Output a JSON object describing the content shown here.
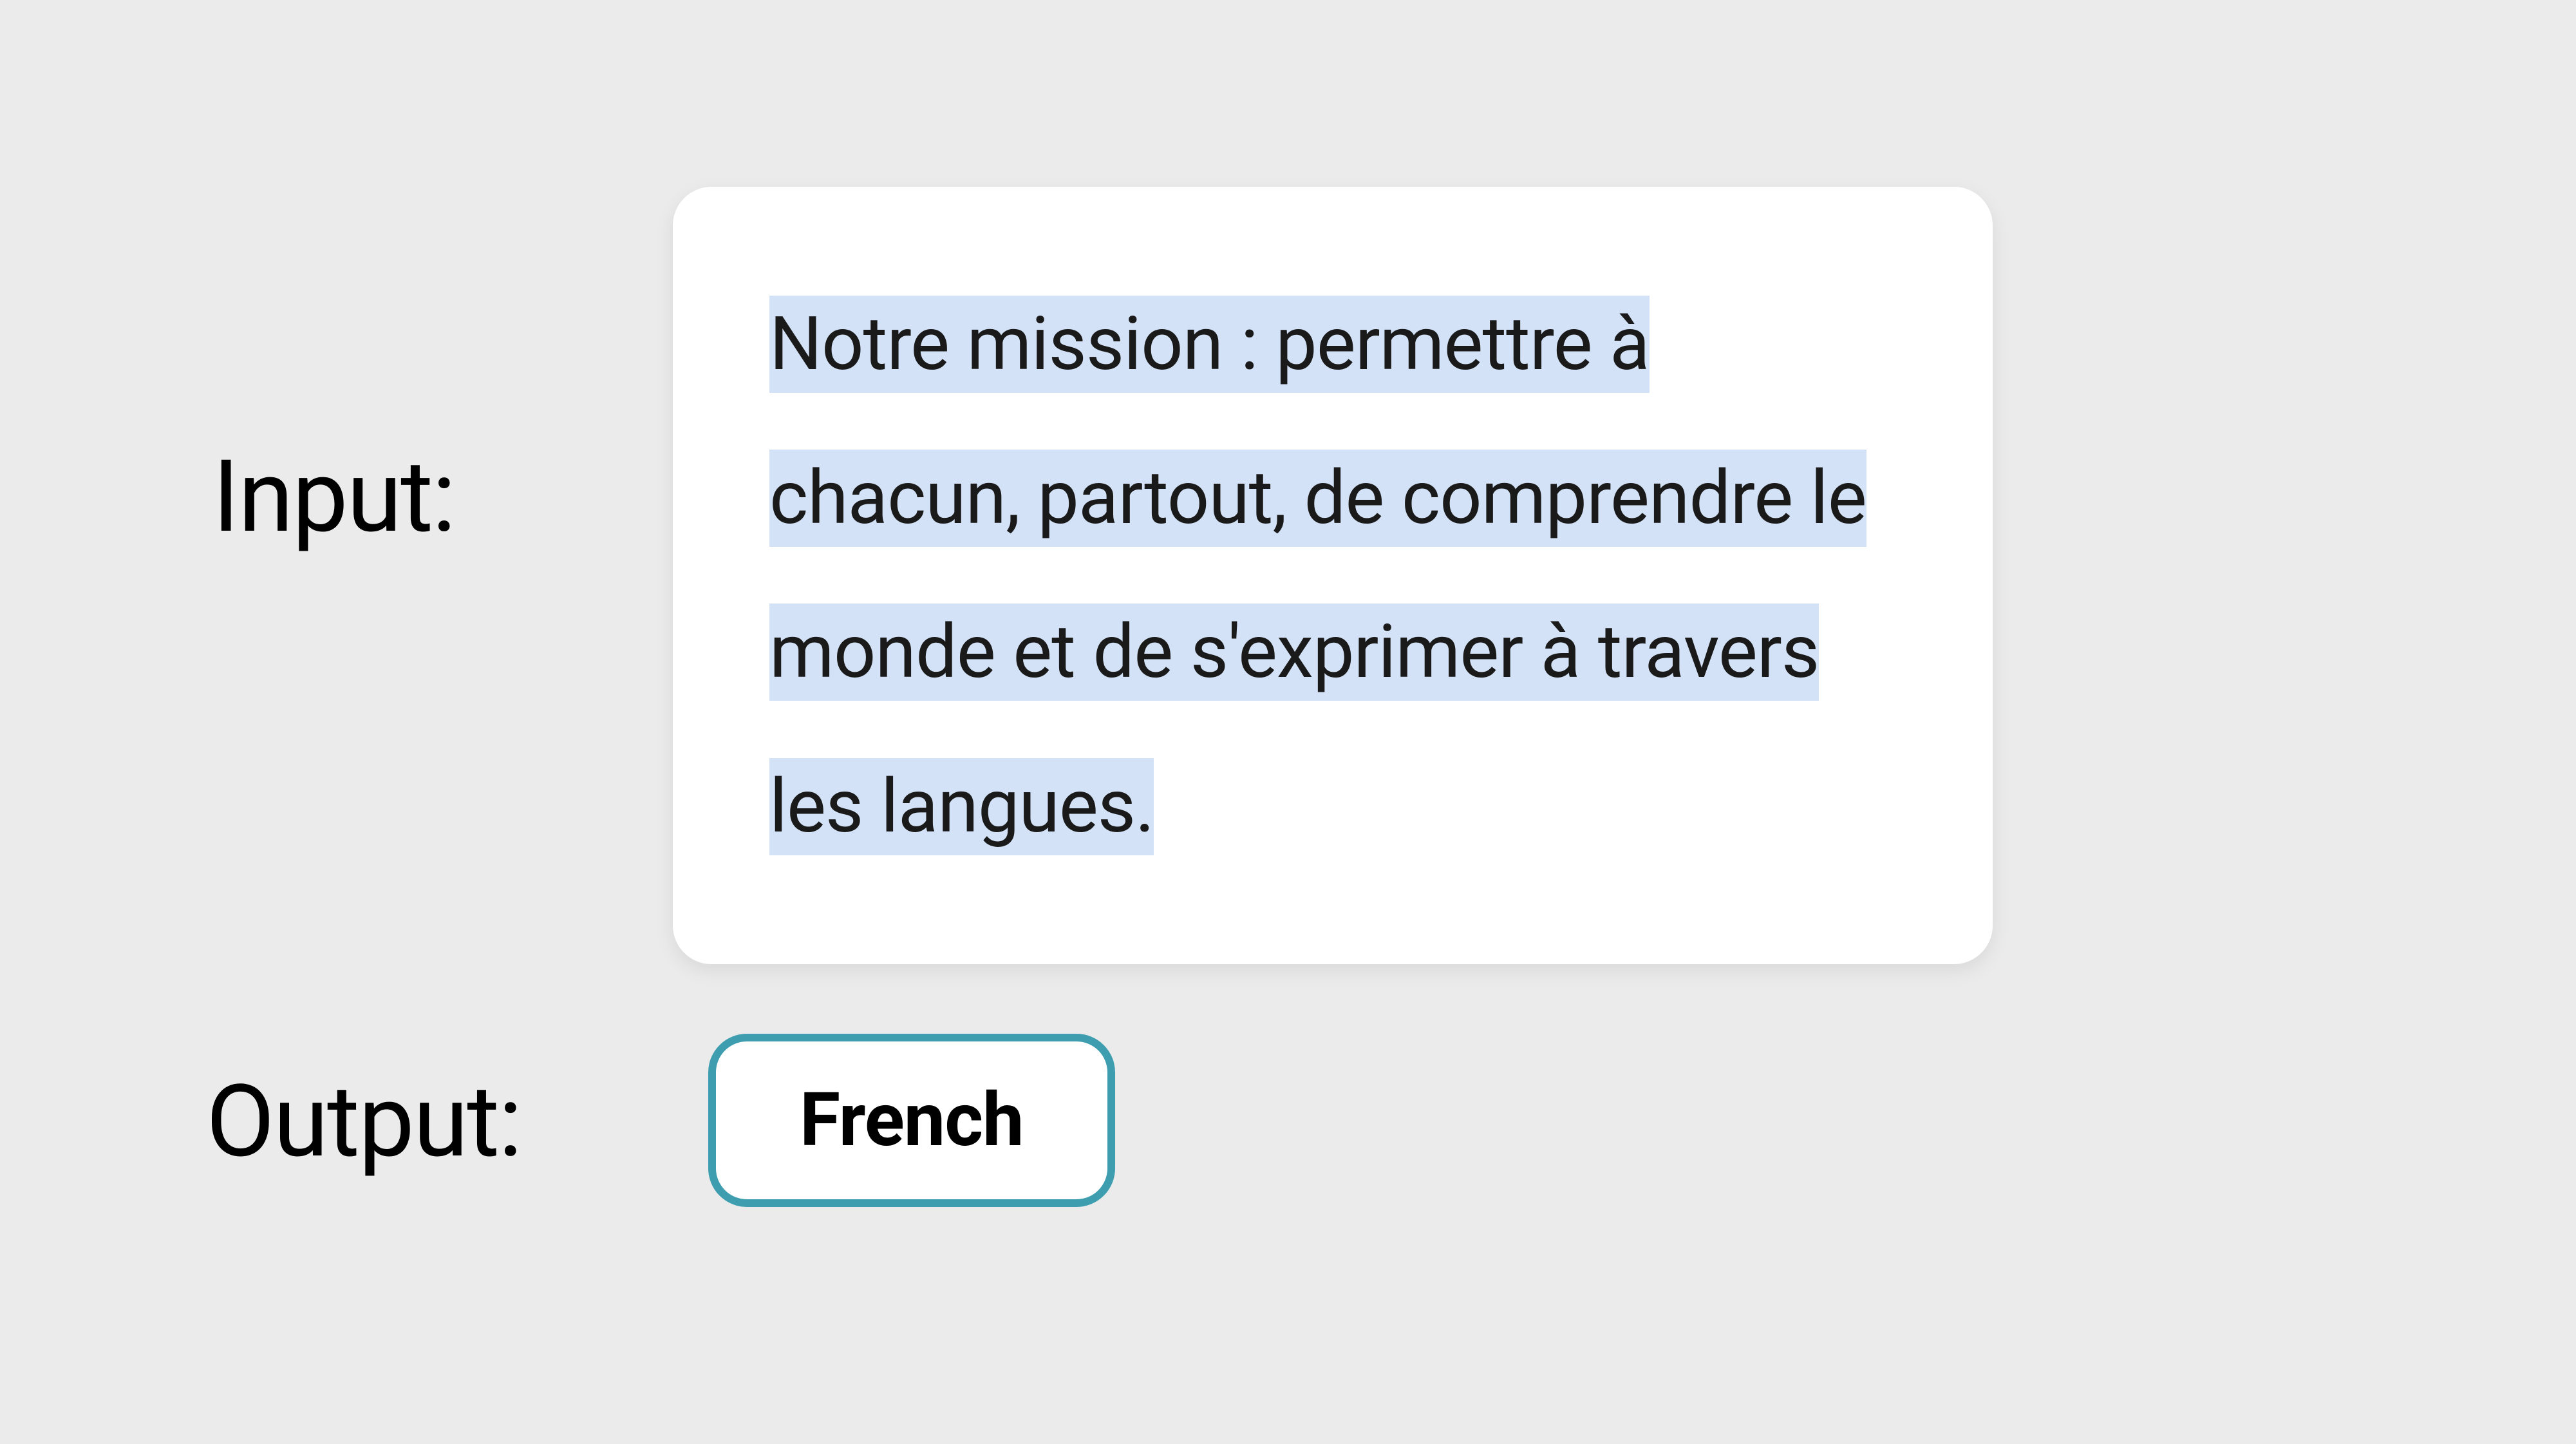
{
  "labels": {
    "input": "Input:",
    "output": "Output:"
  },
  "input_text": "Notre mission : permettre à chacun, partout, de comprendre le monde et de s'exprimer à travers les langues.",
  "output_value": "French",
  "colors": {
    "background": "#ebebeb",
    "card_bg": "#ffffff",
    "highlight": "#d3e2f6",
    "badge_border": "#3e9eb0",
    "text": "#000000"
  }
}
